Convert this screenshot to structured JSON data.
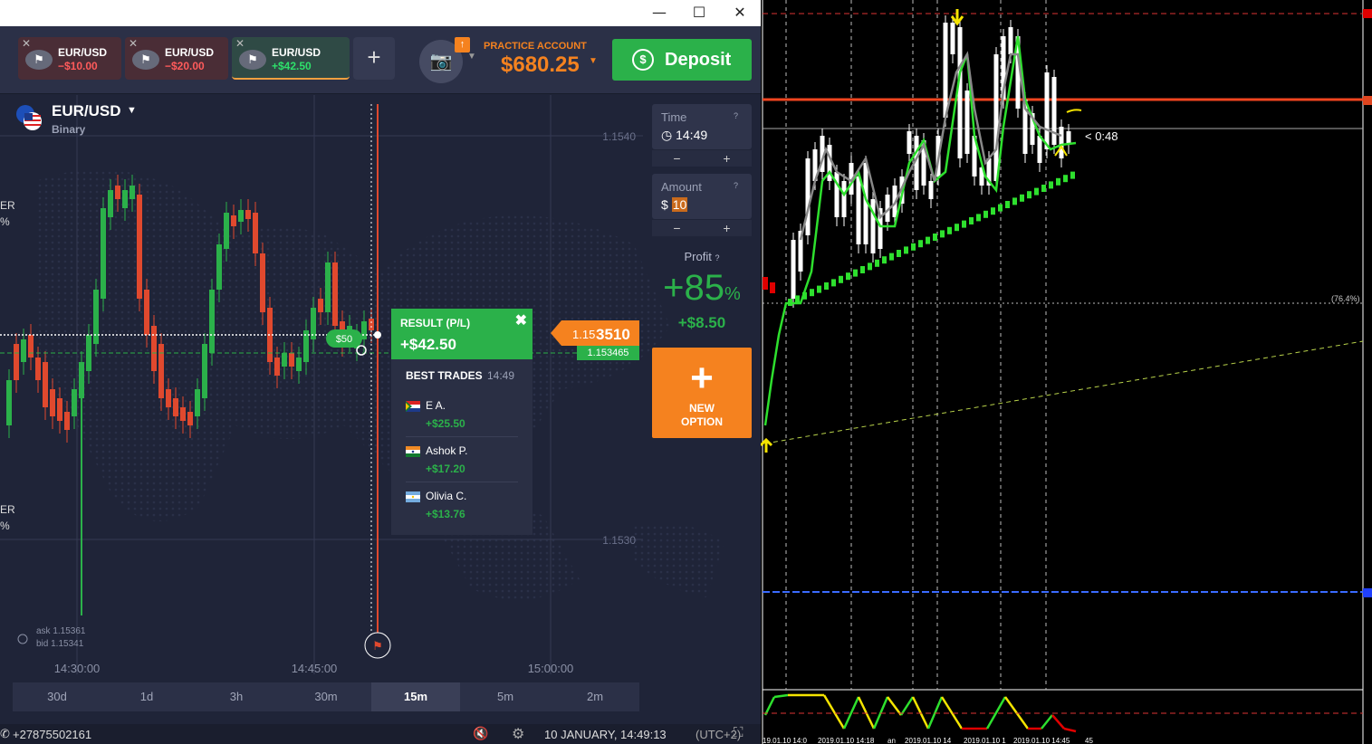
{
  "window": {
    "minimize": "—",
    "maximize": "☐",
    "close": "✕"
  },
  "tabs": [
    {
      "pair": "EUR/USD",
      "value": "−$10.00",
      "color": "#ff5b5b"
    },
    {
      "pair": "EUR/USD",
      "value": "−$20.00",
      "color": "#ff5b5b"
    },
    {
      "pair": "EUR/USD",
      "value": "+$42.50",
      "color": "#2ee06b"
    }
  ],
  "account": {
    "label": "PRACTICE ACCOUNT",
    "balance": "$680.25"
  },
  "deposit": {
    "label": "Deposit"
  },
  "asset": {
    "name": "EUR/USD",
    "type": "Binary"
  },
  "price_scale": [
    "1.1540",
    "1.1530"
  ],
  "time_axis": [
    "14:30:00",
    "14:45:00",
    "15:00:00"
  ],
  "current_price": {
    "prefix": "1.15",
    "big": "3510",
    "small": "1.153465"
  },
  "bet_bubble": "$50",
  "time_panel": {
    "label": "Time",
    "value": "14:49",
    "minus": "−",
    "plus": "+"
  },
  "amount_panel": {
    "label": "Amount",
    "currency": "$",
    "value": "10",
    "minus": "−",
    "plus": "+"
  },
  "profit": {
    "label": "Profit",
    "percent": "+85",
    "pct_sign": "%",
    "amount": "+$8.50"
  },
  "new_option": {
    "line1": "NEW",
    "line2": "OPTION"
  },
  "result": {
    "title": "RESULT (P/L)",
    "value": "+$42.50"
  },
  "best_trades": {
    "title": "BEST TRADES",
    "time": "14:49",
    "items": [
      {
        "name": "E A.",
        "amount": "+$25.50"
      },
      {
        "name": "Ashok P.",
        "amount": "+$17.20"
      },
      {
        "name": "Olivia C.",
        "amount": "+$13.76"
      }
    ]
  },
  "ask_bid": {
    "ask": "ask 1.15361",
    "bid": "bid 1.15341"
  },
  "left_edge": [
    "ER",
    "%",
    "ER",
    "%"
  ],
  "timeframes": [
    "30d",
    "1d",
    "3h",
    "30m",
    "15m",
    "5m",
    "2m"
  ],
  "active_timeframe": "15m",
  "status": {
    "phone": "+27875502161",
    "datetime": "10 JANUARY, 14:49:13",
    "tz": "(UTC+2)"
  },
  "mt4": {
    "countdown": "< 0:48",
    "fib_label": "(76.4%)",
    "bottom_times": [
      "19.01.10 14:0",
      "2019.01.10 14:18",
      "an",
      "2019.01.10 14",
      "2019.01.10 1",
      "2019.01.10 14:45",
      "45"
    ]
  }
}
